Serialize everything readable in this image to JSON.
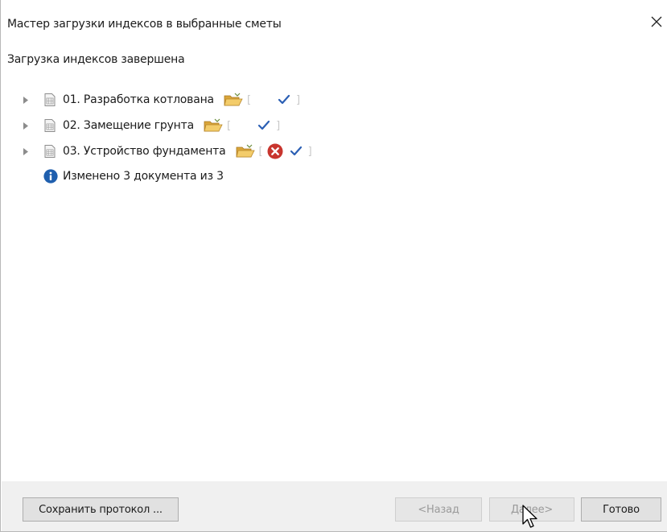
{
  "window": {
    "title": "Мастер загрузки индексов в выбранные сметы",
    "close_glyph": "✕"
  },
  "status": {
    "text": "Загрузка индексов завершена"
  },
  "documents": [
    {
      "label": "01. Разработка котлована",
      "has_error": false,
      "checked": true
    },
    {
      "label": "02. Замещение грунта",
      "has_error": false,
      "checked": true
    },
    {
      "label": "03. Устройство фундамента",
      "has_error": true,
      "checked": true
    }
  ],
  "summary": {
    "text": "Изменено 3 документа из 3",
    "icon": "info-icon"
  },
  "footer": {
    "save_label": "Сохранить протокол ...",
    "back_label": "<Назад",
    "next_label": "Далее>",
    "done_label": "Готово"
  },
  "colors": {
    "check": "#2b5fb4",
    "error": "#c8352e",
    "info": "#1f5fae",
    "folder": "#e6b84a"
  }
}
